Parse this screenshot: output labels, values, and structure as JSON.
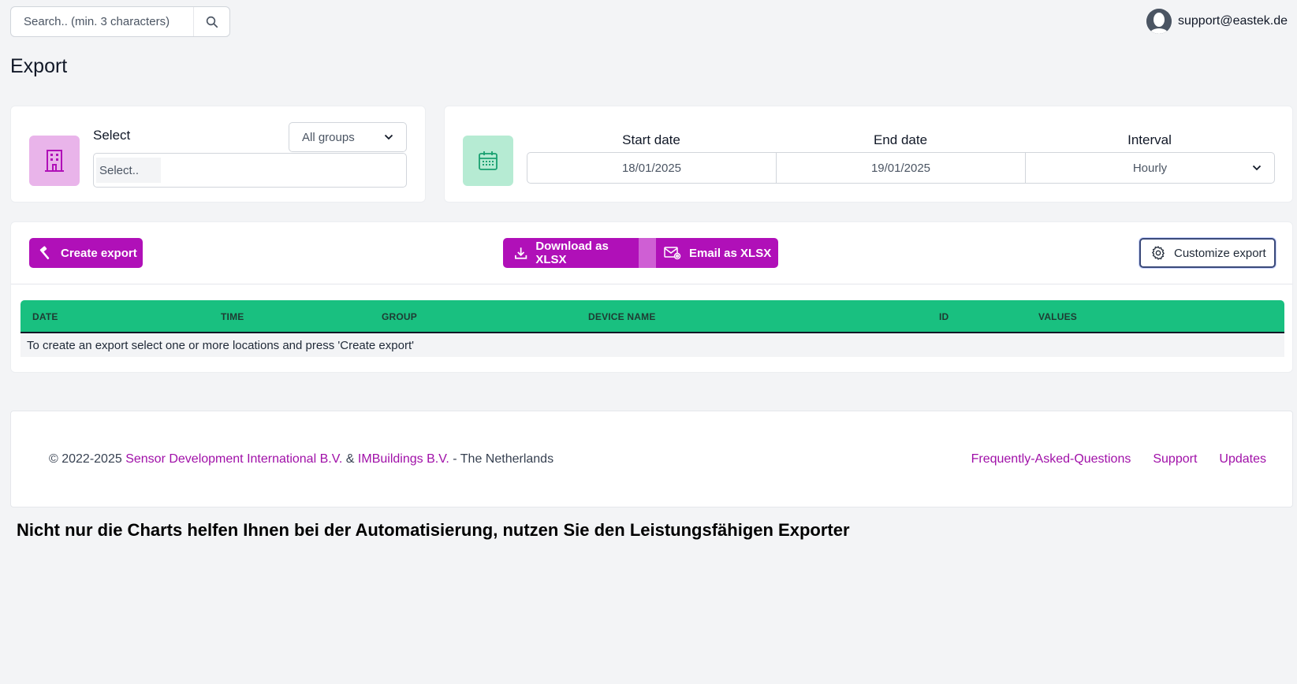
{
  "search": {
    "placeholder": "Search.. (min. 3 characters)"
  },
  "user": {
    "email": "support@eastek.de"
  },
  "page": {
    "title": "Export"
  },
  "select_card": {
    "label": "Select",
    "group_dropdown": "All groups",
    "select_placeholder": "Select.."
  },
  "date_card": {
    "start_label": "Start date",
    "end_label": "End date",
    "interval_label": "Interval",
    "start_value": "18/01/2025",
    "end_value": "19/01/2025",
    "interval_value": "Hourly"
  },
  "toolbar": {
    "create_label": "Create export",
    "download_label": "Download as XLSX",
    "email_label": "Email as XLSX",
    "customize_label": "Customize export"
  },
  "table": {
    "columns": [
      "DATE",
      "TIME",
      "GROUP",
      "DEVICE NAME",
      "ID",
      "VALUES"
    ],
    "empty_message": "To create an export select one or more locations and press 'Create export'"
  },
  "footer": {
    "copyright": "© 2022-2025",
    "company1": "Sensor Development International B.V.",
    "amp": "&",
    "company2": "IMBuildings B.V.",
    "country": "- The Netherlands",
    "links": [
      "Frequently-Asked-Questions",
      "Support",
      "Updates"
    ]
  },
  "caption": "Nicht nur die Charts helfen Ihnen bei der Automatisierung, nutzen Sie den Leistungsfähigen Exporter",
  "colors": {
    "accent": "#b010b8",
    "table_header": "#19c080",
    "link": "#a010a8",
    "background": "#f3f4f6"
  }
}
